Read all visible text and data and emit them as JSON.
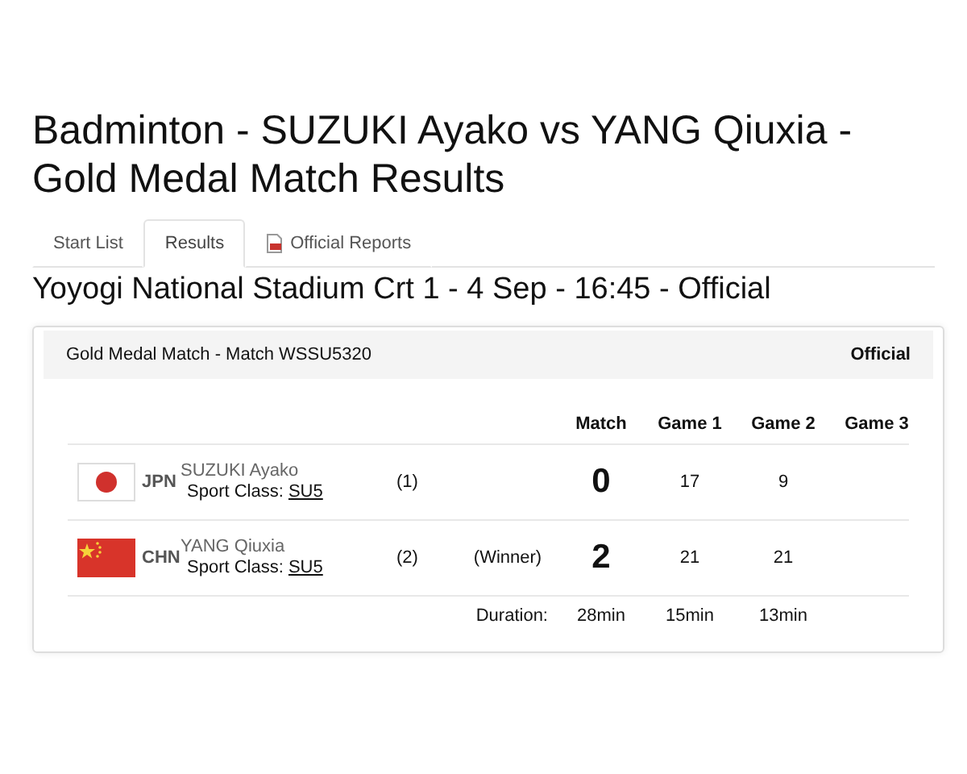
{
  "title": "Badminton - SUZUKI Ayako vs YANG Qiuxia - Gold Medal Match Results",
  "tabs": [
    {
      "label": "Start List",
      "selected": false,
      "icon": false
    },
    {
      "label": "Results",
      "selected": true,
      "icon": false
    },
    {
      "label": "Official Reports",
      "selected": false,
      "icon": true
    }
  ],
  "subtitle": "Yoyogi National Stadium Crt 1 - 4 Sep - 16:45 - Official",
  "card": {
    "heading": "Gold Medal Match  - Match WSSU5320",
    "status": "Official",
    "columns": [
      "Match",
      "Game 1",
      "Game 2",
      "Game 3"
    ],
    "rows": [
      {
        "kind": "jpn",
        "code": "JPN",
        "name": "SUZUKI Ayako",
        "sport_class_label": "Sport Class:",
        "sport_class": "SU5",
        "seed": "(1)",
        "match": "0",
        "games": [
          "17",
          "9"
        ]
      },
      {
        "kind": "chn",
        "code": "CHN",
        "name": "YANG Qiuxia",
        "sport_class_label": "Sport Class:",
        "sport_class": "SU5",
        "seed": "(2)",
        "winner": "(Winner)",
        "match": "2",
        "games": [
          "21",
          "21"
        ]
      }
    ],
    "duration": {
      "label": "Duration:",
      "match": "28min",
      "games": [
        "15min",
        "13min"
      ]
    }
  }
}
